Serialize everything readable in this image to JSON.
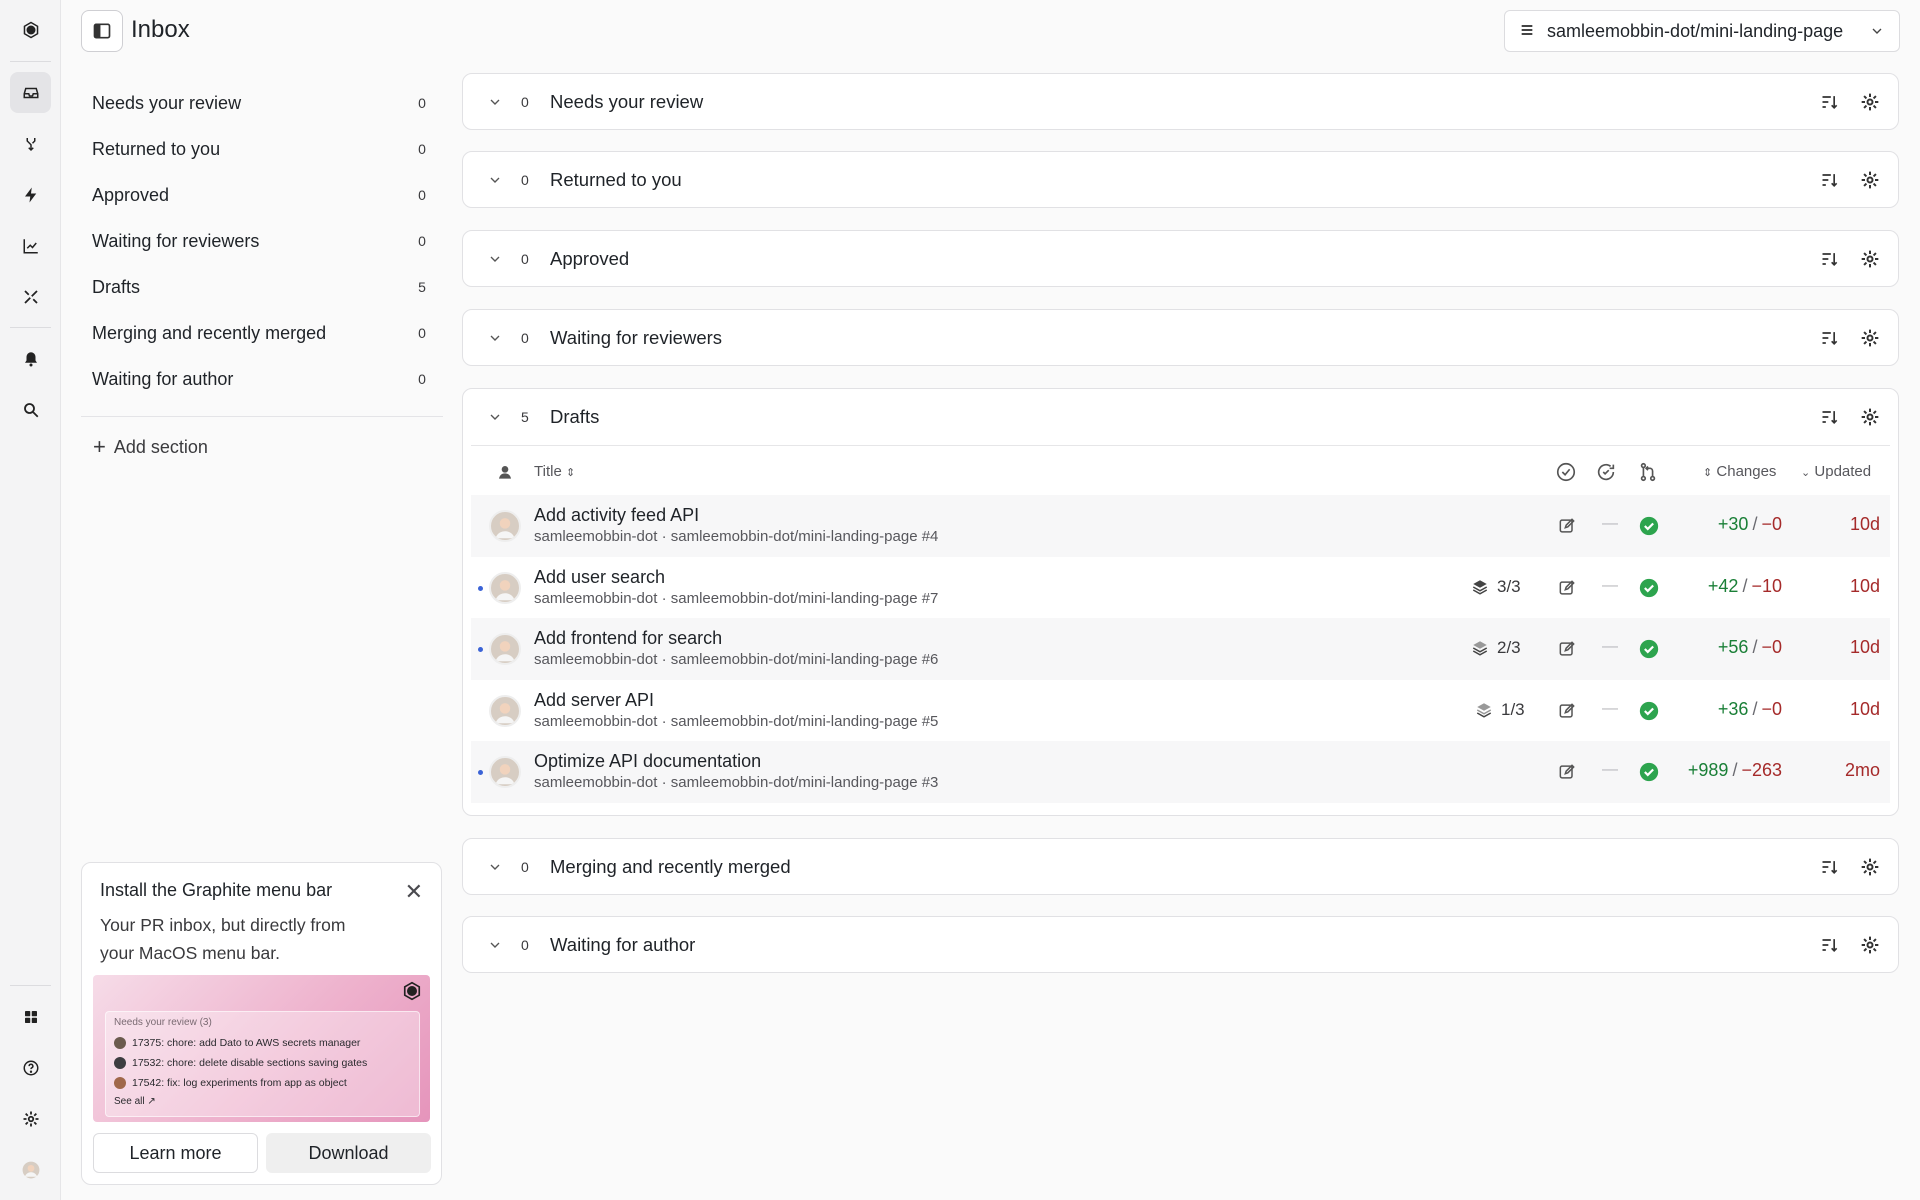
{
  "header": {
    "title": "Inbox",
    "repo": "samleemobbin-dot/mini-landing-page"
  },
  "rail": {
    "icons": [
      "graphite-logo-icon",
      "inbox-icon",
      "merge-icon",
      "bolt-icon",
      "chart-icon",
      "tools-icon",
      "bell-icon",
      "search-icon",
      "apps-icon",
      "help-icon",
      "settings-icon",
      "avatar"
    ]
  },
  "nav": {
    "items": [
      {
        "label": "Needs your review",
        "count": "0"
      },
      {
        "label": "Returned to you",
        "count": "0"
      },
      {
        "label": "Approved",
        "count": "0"
      },
      {
        "label": "Waiting for reviewers",
        "count": "0"
      },
      {
        "label": "Drafts",
        "count": "5"
      },
      {
        "label": "Merging and recently merged",
        "count": "0"
      },
      {
        "label": "Waiting for author",
        "count": "0"
      }
    ],
    "add_section": "Add section"
  },
  "promo": {
    "title": "Install the Graphite menu bar",
    "body": "Your PR inbox, but directly from your MacOS menu bar.",
    "preview": {
      "head": "Needs your review (3)",
      "rows": [
        "17375: chore: add Dato to AWS secrets manager",
        "17532: chore: delete disable sections saving gates",
        "17542: fix: log experiments from app as object"
      ],
      "see_all": "See all ↗"
    },
    "learn_more": "Learn more",
    "download": "Download"
  },
  "sections": {
    "s0": {
      "count": "0",
      "title": "Needs your review"
    },
    "s1": {
      "count": "0",
      "title": "Returned to you"
    },
    "s2": {
      "count": "0",
      "title": "Approved"
    },
    "s3": {
      "count": "0",
      "title": "Waiting for reviewers"
    },
    "s4": {
      "count": "5",
      "title": "Drafts"
    },
    "s5": {
      "count": "0",
      "title": "Merging and recently merged"
    },
    "s6": {
      "count": "0",
      "title": "Waiting for author"
    }
  },
  "drafts_table": {
    "col_title": "Title",
    "col_changes": "Changes",
    "col_updated": "Updated",
    "rows": [
      {
        "title": "Add activity feed API",
        "sub": "samleemobbin-dot · samleemobbin-dot/mini-landing-page #4",
        "stack": "",
        "added": "+30",
        "removed": "−0",
        "updated": "10d",
        "unread": false
      },
      {
        "title": "Add user search",
        "sub": "samleemobbin-dot · samleemobbin-dot/mini-landing-page #7",
        "stack": "3/3",
        "added": "+42",
        "removed": "−10",
        "updated": "10d",
        "unread": true
      },
      {
        "title": "Add frontend for search",
        "sub": "samleemobbin-dot · samleemobbin-dot/mini-landing-page #6",
        "stack": "2/3",
        "added": "+56",
        "removed": "−0",
        "updated": "10d",
        "unread": true
      },
      {
        "title": "Add server API",
        "sub": "samleemobbin-dot · samleemobbin-dot/mini-landing-page #5",
        "stack": "1/3",
        "added": "+36",
        "removed": "−0",
        "updated": "10d",
        "unread": false
      },
      {
        "title": "Optimize API documentation",
        "sub": "samleemobbin-dot · samleemobbin-dot/mini-landing-page #3",
        "stack": "",
        "added": "+989",
        "removed": "−263",
        "updated": "2mo",
        "unread": true
      }
    ]
  },
  "colors": {
    "success": "#2da44e",
    "added": "#1a7f37",
    "removed": "#a52a2a",
    "unread_dot": "#3b63d6"
  }
}
